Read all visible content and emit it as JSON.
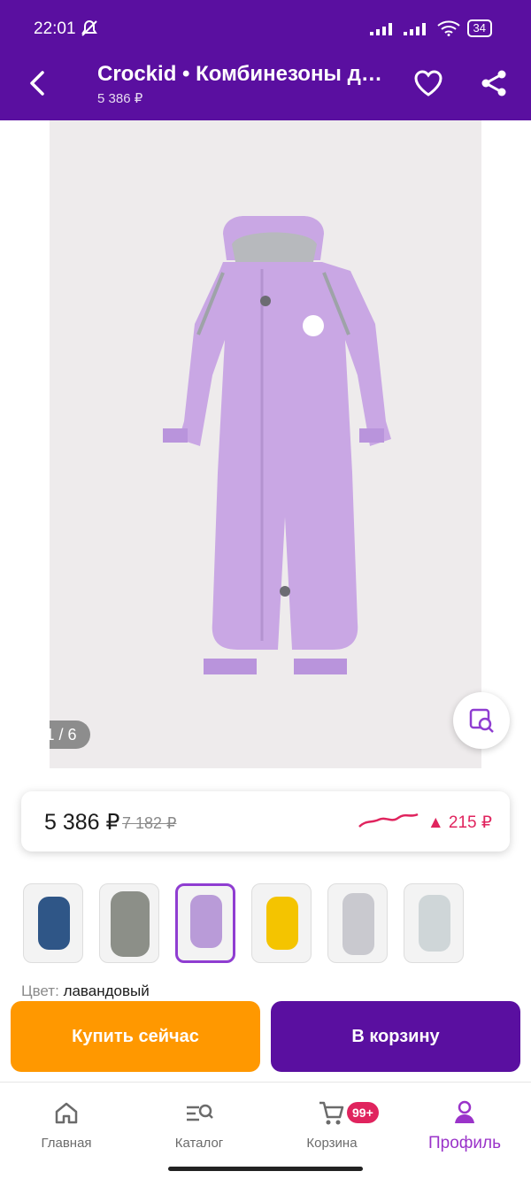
{
  "status": {
    "time": "22:01",
    "battery": "34"
  },
  "header": {
    "title": "Crockid • Комбинезоны д…",
    "subtitle": "5 386 ₽"
  },
  "gallery": {
    "counter": "1 / 6"
  },
  "price": {
    "current": "5 386 ₽",
    "old": "7 182 ₽",
    "delta": "▲ 215 ₽"
  },
  "thumbnails": [
    {
      "name": "navy",
      "color": "#2f5687"
    },
    {
      "name": "grey-print",
      "color": "#8c8f88"
    },
    {
      "name": "lavender",
      "color": "#b99bd8"
    },
    {
      "name": "yellow",
      "color": "#f4c400"
    },
    {
      "name": "print",
      "color": "#c9c9cf"
    },
    {
      "name": "light-grey",
      "color": "#cfd6d8"
    }
  ],
  "color_info": {
    "label": "Цвет:",
    "value": "лавандовый"
  },
  "actions": {
    "buy_now": "Купить сейчас",
    "add_to_cart": "В корзину"
  },
  "bottom_nav": [
    {
      "label": "Главная",
      "icon": "home-icon"
    },
    {
      "label": "Каталог",
      "icon": "catalog-search-icon"
    },
    {
      "label": "Корзина",
      "icon": "cart-icon",
      "badge": "99+"
    },
    {
      "label": "Профиль",
      "icon": "profile-icon",
      "active": true
    }
  ],
  "colors": {
    "brand": "#5a0fa0",
    "accent": "#ff9800",
    "active": "#9a33c9",
    "alert": "#e0245e"
  }
}
